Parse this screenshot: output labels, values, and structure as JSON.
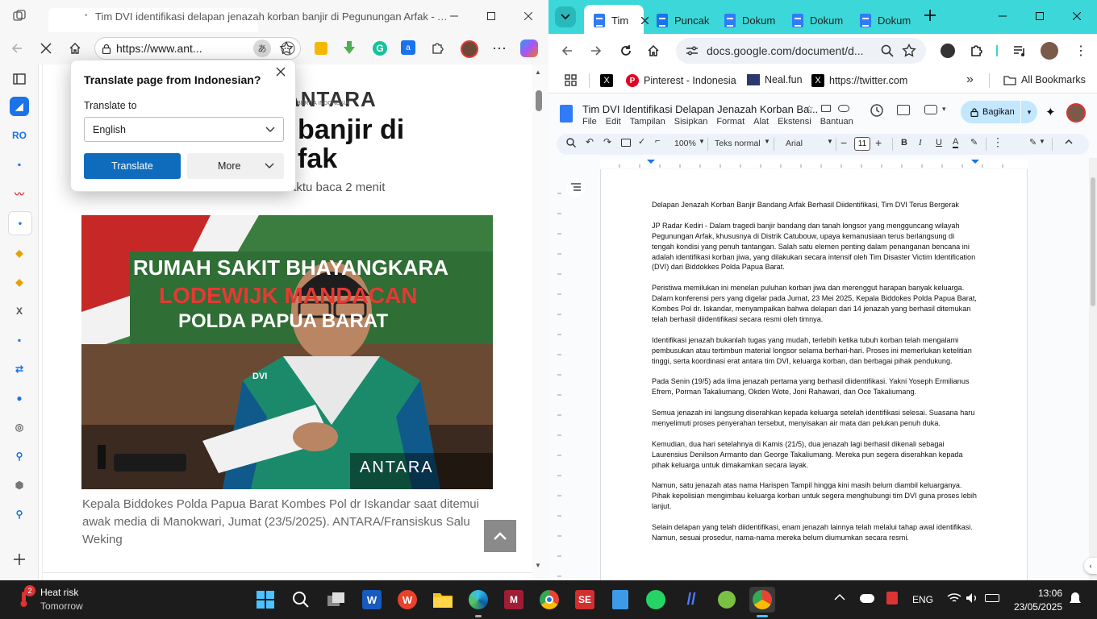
{
  "edge": {
    "tab_title": "Tim DVI identifikasi delapan jenazah korban banjir di Pegunungan Arfak - A...",
    "url": "https://www.ant...",
    "translate_badge": "あ",
    "site_logo": "ANTARA",
    "site_tagline": "KANTOR BERITA INDONESIA",
    "headline_line1": "banjir di",
    "headline_line2": "fak",
    "read_time": "aktu baca 2 menit",
    "caption": "Kepala Biddokes Polda Papua Barat Kombes Pol dr Iskandar saat ditemui awak media di Manokwari, Jumat (23/5/2025). ANTARA/Fransiskus Salu Weking",
    "photo": {
      "banner_line1": "RUMAH SAKIT BHAYANGKARA",
      "banner_line2": "LODEWIJK MANDACAN",
      "banner_line3": "POLDA PAPUA BARAT",
      "shirt_label": "DVI",
      "watermark": "ANTARA"
    },
    "translate_popup": {
      "heading": "Translate page from Indonesian?",
      "label": "Translate to",
      "selected_language": "English",
      "translate_button": "Translate",
      "more_button": "More"
    }
  },
  "chrome": {
    "tabs": [
      {
        "label": "Tim"
      },
      {
        "label": "Puncak"
      },
      {
        "label": "Dokum"
      },
      {
        "label": "Dokum"
      },
      {
        "label": "Dokum"
      }
    ],
    "url": "docs.google.com/document/d...",
    "bookmarks": [
      {
        "label": "Pinterest - Indonesia"
      },
      {
        "label": "Neal.fun"
      },
      {
        "label": "https://twitter.com"
      }
    ],
    "all_bookmarks": "All Bookmarks",
    "doc": {
      "title": "Tim DVI Identifikasi Delapan Jenazah Korban Ba...",
      "menu": [
        "File",
        "Edit",
        "Tampilan",
        "Sisipkan",
        "Format",
        "Alat",
        "Ekstensi",
        "Bantuan"
      ],
      "share_button": "Bagikan",
      "zoom": "100%",
      "style": "Teks normal",
      "font": "Arial",
      "font_size": "11",
      "paragraphs": [
        "Delapan Jenazah Korban Banjir Bandang Arfak Berhasil Diidentifikasi, Tim DVI Terus Bergerak",
        "JP Radar Kediri - Dalam tragedi banjir bandang dan tanah longsor yang mengguncang wilayah Pegunungan Arfak, khususnya di Distrik Catubouw, upaya kemanusiaan terus berlangsung di tengah kondisi yang penuh tantangan. Salah satu elemen penting dalam penanganan bencana ini adalah identifikasi korban jiwa, yang dilakukan secara intensif oleh Tim Disaster Victim Identification (DVI) dari Biddokkes Polda Papua Barat.",
        "Peristiwa memilukan ini menelan puluhan korban jiwa dan merenggut harapan banyak keluarga. Dalam konferensi pers yang digelar pada Jumat, 23 Mei 2025, Kepala Biddokes Polda Papua Barat, Kombes Pol dr. Iskandar, menyampaikan bahwa delapan dari 14 jenazah yang berhasil ditemukan telah berhasil diidentifikasi secara resmi oleh timnya.",
        "Identifikasi jenazah bukanlah tugas yang mudah, terlebih ketika tubuh korban telah mengalami pembusukan atau tertimbun material longsor selama berhari-hari. Proses ini memerlukan ketelitian tinggi, serta koordinasi erat antara tim DVI, keluarga korban, dan berbagai pihak pendukung.",
        "Pada Senin (19/5) ada lima jenazah pertama yang berhasil diidentifikasi. Yakni Yoseph Ermilianus Efrem, Porman Takaliumang, Okden Wote, Joni Rahawari, dan Oce Takaliumang.",
        "Semua jenazah ini langsung diserahkan kepada keluarga setelah identifikasi selesai. Suasana haru menyelimuti proses penyerahan tersebut, menyisakan air mata dan pelukan penuh duka.",
        "Kemudian, dua hari setelahnya di Kamis (21/5), dua jenazah lagi berhasil dikenali sebagai Laurensius Denilson Armanto dan George Takaliumang. Mereka pun segera diserahkan kepada pihak keluarga untuk dimakamkan secara layak.",
        "Namun, satu jenazah atas nama Harispen Tampil hingga kini masih belum diambil keluarganya. Pihak kepolisian mengimbau keluarga korban untuk segera menghubungi tim DVI guna proses lebih lanjut.",
        "Selain delapan yang telah diidentifikasi, enam jenazah lainnya telah melalui tahap awal identifikasi. Namun, sesuai prosedur, nama-nama mereka belum diumumkan secara resmi."
      ]
    }
  },
  "taskbar": {
    "weather_badge": "2",
    "weather_title": "Heat risk",
    "weather_sub": "Tomorrow",
    "language": "ENG",
    "time": "13:06",
    "date": "23/05/2025"
  },
  "colors": {
    "edge_blue": "#0f6cbd",
    "chrome_tab_strip": "#3cd7d8",
    "docs_blue": "#2f7cf6",
    "share_bg": "#c2e7ff"
  }
}
